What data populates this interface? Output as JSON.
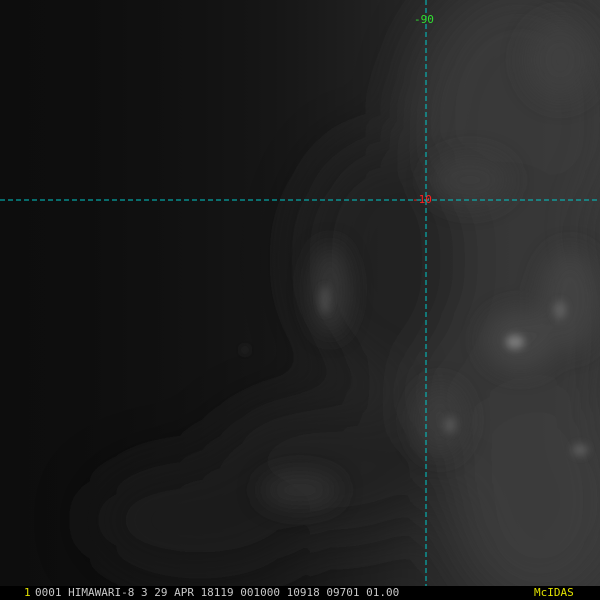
{
  "overlay": {
    "longitude_label": "-90",
    "latitude_label": "-10",
    "grid_color": "#00c8c8",
    "longitude_label_color": "#30e030",
    "latitude_label_color": "#ff2020"
  },
  "status_bar": {
    "frame_number": "1",
    "header_text": "0001 HIMAWARI-8   3 29 APR 18119 001000 10918 09701 01.00",
    "brand": "McIDAS",
    "frame_number_color": "#e0e000",
    "header_text_color": "#c8c8c8",
    "brand_color": "#e0e000"
  }
}
